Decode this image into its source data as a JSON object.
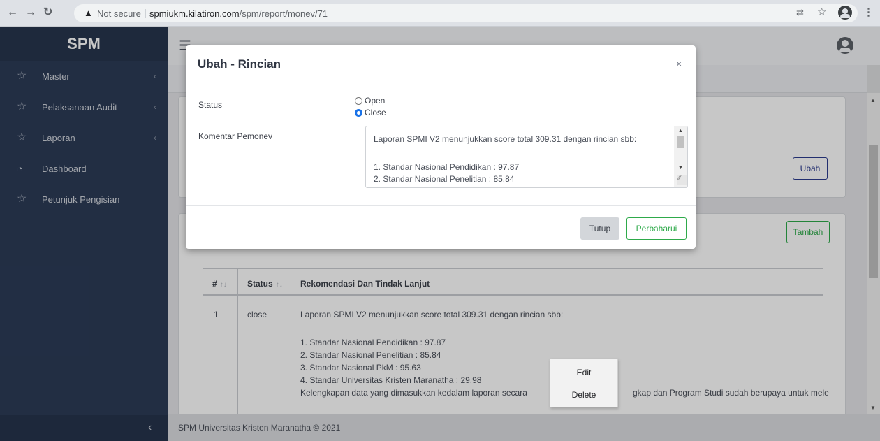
{
  "browser": {
    "not_secure": "Not secure",
    "url_host": "spmiukm.kilatiron.com",
    "url_path": "/spm/report/monev/71"
  },
  "sidebar": {
    "brand": "SPM",
    "items": [
      {
        "label": "Master",
        "icon": "star-icon",
        "has_chevron": true
      },
      {
        "label": "Pelaksanaan Audit",
        "icon": "star-icon",
        "has_chevron": true
      },
      {
        "label": "Laporan",
        "icon": "star-icon",
        "has_chevron": true
      },
      {
        "label": "Dashboard",
        "icon": "speedometer-icon",
        "has_chevron": false
      },
      {
        "label": "Petunjuk Pengisian",
        "icon": "star-icon",
        "has_chevron": false
      }
    ]
  },
  "page": {
    "ubah_label": "Ubah",
    "tambah_label": "Tambah",
    "table": {
      "headers": [
        "#",
        "Status",
        "Rekomendasi Dan Tindak Lanjut"
      ],
      "rows": [
        {
          "no": "1",
          "status": "close",
          "lines": [
            "Laporan SPMI V2 menunjukkan score total 309.31 dengan rincian sbb:",
            "1. Standar Nasional Pendidikan : 97.87",
            "2. Standar Nasional Penelitian : 85.84",
            "3. Standar Nasional PkM : 95.63",
            "4. Standar Universitas Kristen Maranatha : 29.98",
            "Kelengkapan data yang dimasukkan kedalam laporan secara",
            "gkap dan Program Studi sudah berupaya untuk mele"
          ]
        }
      ]
    },
    "footer": "SPM Universitas Kristen Maranatha © 2021"
  },
  "modal": {
    "title": "Ubah - Rincian",
    "close_symbol": "×",
    "status_label": "Status",
    "status_options": [
      {
        "label": "Open",
        "checked": false
      },
      {
        "label": "Close",
        "checked": true
      }
    ],
    "comment_label": "Komentar Pemonev",
    "comment_lines": [
      "Laporan SPMI V2 menunjukkan score total 309.31 dengan rincian sbb:",
      "1. Standar Nasional Pendidikan : 97.87",
      "2. Standar Nasional Penelitian : 85.84"
    ],
    "tutup_label": "Tutup",
    "perbaharui_label": "Perbaharui"
  },
  "context_menu": {
    "items": [
      "Edit",
      "Delete"
    ]
  },
  "colors": {
    "sidebar_bg": "#2c3b57",
    "success": "#2eaa4a",
    "primary_outline": "#2c3b8f",
    "radio_checked": "#1a73e8"
  }
}
